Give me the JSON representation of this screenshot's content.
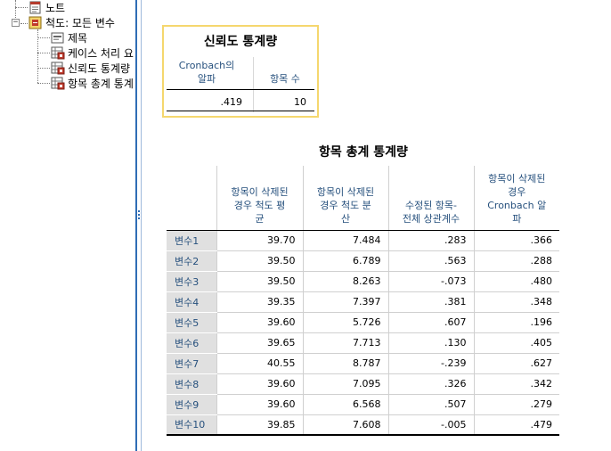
{
  "outline": {
    "items": [
      {
        "label": "노트",
        "icon": "notes-icon"
      },
      {
        "label": "척도: 모든 변수",
        "icon": "log-icon",
        "expander": "−"
      },
      {
        "label": "제목",
        "icon": "title-icon"
      },
      {
        "label": "케이스 처리 요",
        "icon": "table-icon"
      },
      {
        "label": "신뢰도 통계량",
        "icon": "table-icon"
      },
      {
        "label": "항목 총계 통계",
        "icon": "table-icon"
      }
    ]
  },
  "reliability_table": {
    "title": "신뢰도 통계량",
    "headers": [
      "Cronbach의\n알파",
      "항목 수"
    ],
    "values": [
      ".419",
      "10"
    ]
  },
  "item_total_table": {
    "title": "항목 총계 통계량",
    "headers": [
      "항목이 삭제된\n경우 척도 평\n균",
      "항목이 삭제된\n경우 척도 분\n산",
      "수정된 항목-\n전체 상관계수",
      "항목이 삭제된\n경우\nCronbach 알\n파"
    ],
    "rows": [
      {
        "label": "변수1",
        "values": [
          "39.70",
          "7.484",
          ".283",
          ".366"
        ]
      },
      {
        "label": "변수2",
        "values": [
          "39.50",
          "6.789",
          ".563",
          ".288"
        ]
      },
      {
        "label": "변수3",
        "values": [
          "39.50",
          "8.263",
          "-.073",
          ".480"
        ]
      },
      {
        "label": "변수4",
        "values": [
          "39.35",
          "7.397",
          ".381",
          ".348"
        ]
      },
      {
        "label": "변수5",
        "values": [
          "39.60",
          "5.726",
          ".607",
          ".196"
        ]
      },
      {
        "label": "변수6",
        "values": [
          "39.65",
          "7.713",
          ".130",
          ".405"
        ]
      },
      {
        "label": "변수7",
        "values": [
          "40.55",
          "8.787",
          "-.239",
          ".627"
        ]
      },
      {
        "label": "변수8",
        "values": [
          "39.60",
          "7.095",
          ".326",
          ".342"
        ]
      },
      {
        "label": "변수9",
        "values": [
          "39.60",
          "6.568",
          ".507",
          ".279"
        ]
      },
      {
        "label": "변수10",
        "values": [
          "39.85",
          "7.608",
          "-.005",
          ".479"
        ]
      }
    ]
  },
  "colors": {
    "header_text": "#26507d",
    "selection_border": "#f5d76e",
    "row_label_bg": "#e0e0e0",
    "splitter": "#2f6db5"
  }
}
